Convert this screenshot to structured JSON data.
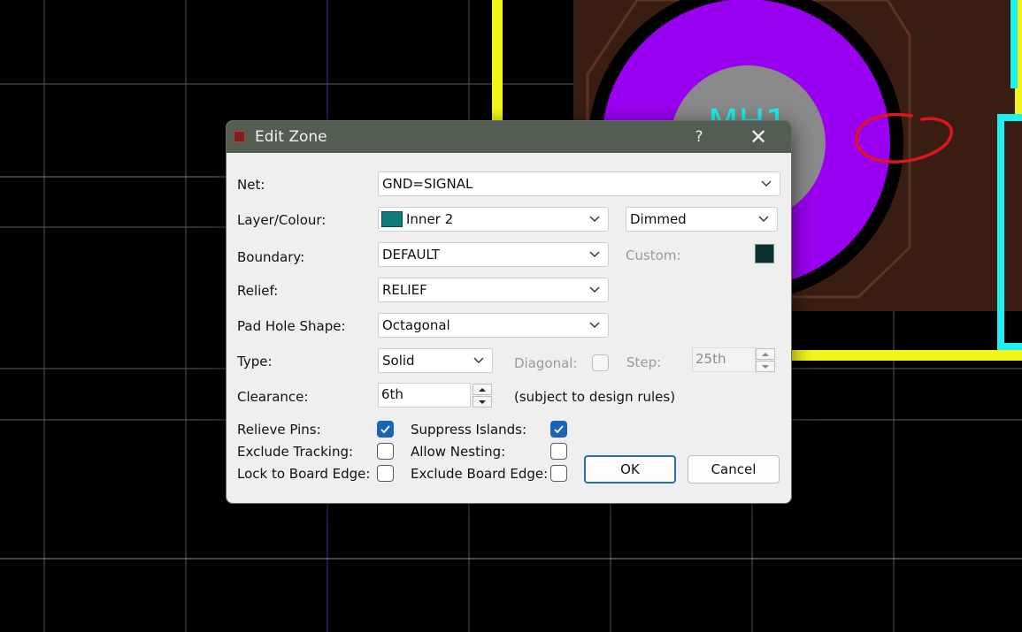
{
  "background": {
    "component_label": "MH1",
    "colors": {
      "board": "#000000",
      "grid": "#5a5a5a",
      "pad": "#9a00f0",
      "drill": "#8a8a8a",
      "copper": "#3a1d12",
      "outline": "#f5f51e",
      "silk": "#1ff0f0"
    }
  },
  "dialog": {
    "title": "Edit Zone",
    "help_label": "?",
    "close_label": "✕",
    "net": {
      "label": "Net:",
      "value": "GND=SIGNAL"
    },
    "layer": {
      "label": "Layer/Colour:",
      "value": "Inner 2",
      "swatch_color": "#0f7c7a",
      "display_value": "Dimmed"
    },
    "boundary": {
      "label": "Boundary:",
      "value": "DEFAULT",
      "custom_label": "Custom:",
      "custom_color": "#0a2f30"
    },
    "relief": {
      "label": "Relief:",
      "value": "RELIEF"
    },
    "pad_hole_shape": {
      "label": "Pad Hole Shape:",
      "value": "Octagonal"
    },
    "type": {
      "label": "Type:",
      "value": "Solid",
      "diagonal_label": "Diagonal:",
      "diagonal_checked": false,
      "step_label": "Step:",
      "step_value": "25th"
    },
    "clearance": {
      "label": "Clearance:",
      "value": "6th",
      "note": "(subject to design rules)"
    },
    "options": {
      "relieve_pins": {
        "label": "Relieve Pins:",
        "checked": true
      },
      "exclude_tracking": {
        "label": "Exclude Tracking:",
        "checked": false
      },
      "lock_to_board_edge": {
        "label": "Lock to Board Edge:",
        "checked": false
      },
      "suppress_islands": {
        "label": "Suppress Islands:",
        "checked": true
      },
      "allow_nesting": {
        "label": "Allow Nesting:",
        "checked": false
      },
      "exclude_board_edge": {
        "label": "Exclude Board Edge:",
        "checked": false
      }
    },
    "ok_label": "OK",
    "cancel_label": "Cancel"
  },
  "annotations": {
    "color": "#e0141e"
  }
}
